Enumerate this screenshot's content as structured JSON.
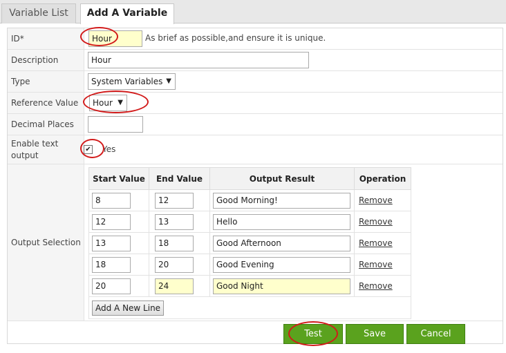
{
  "tabs": [
    {
      "label": "Variable List",
      "active": false
    },
    {
      "label": "Add A Variable",
      "active": true
    }
  ],
  "form": {
    "id": {
      "label": "ID*",
      "value": "Hour",
      "hint": "As brief as possible,and ensure it is unique."
    },
    "description": {
      "label": "Description",
      "value": "Hour"
    },
    "type": {
      "label": "Type",
      "value": "System Variables"
    },
    "reference_value": {
      "label": "Reference Value",
      "value": "Hour"
    },
    "decimal_places": {
      "label": "Decimal Places",
      "value": ""
    },
    "enable_text_output": {
      "label": "Enable text output",
      "checked": true,
      "option_label": "Yes"
    },
    "output_selection": {
      "label": "Output Selection",
      "headers": [
        "Start Value",
        "End Value",
        "Output Result",
        "Operation"
      ],
      "rows": [
        {
          "start": "8",
          "end": "12",
          "result": "Good Morning!",
          "op": "Remove"
        },
        {
          "start": "12",
          "end": "13",
          "result": "Hello",
          "op": "Remove"
        },
        {
          "start": "13",
          "end": "18",
          "result": "Good Afternoon",
          "op": "Remove"
        },
        {
          "start": "18",
          "end": "20",
          "result": "Good Evening",
          "op": "Remove"
        },
        {
          "start": "20",
          "end": "24",
          "result": "Good Night",
          "op": "Remove"
        }
      ],
      "add_line_label": "Add A New Line"
    }
  },
  "buttons": {
    "test": "Test",
    "save": "Save",
    "cancel": "Cancel"
  },
  "colors": {
    "button_green": "#5aa21e",
    "highlight_oval": "#d21a1a",
    "input_highlight": "#ffffcc"
  }
}
